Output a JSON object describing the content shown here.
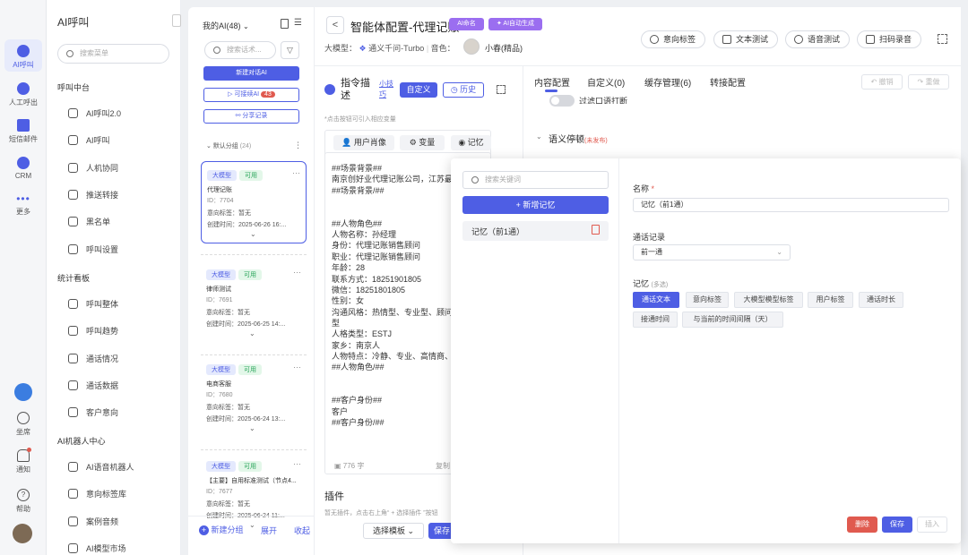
{
  "rail": {
    "items": [
      {
        "label": "AI呼叫",
        "icon": "ai-call-icon"
      },
      {
        "label": "人工呼出",
        "icon": "manual-call-icon"
      },
      {
        "label": "短信邮件",
        "icon": "sms-mail-icon"
      },
      {
        "label": "CRM",
        "icon": "crm-icon"
      },
      {
        "label": "更多",
        "icon": "more-icon"
      }
    ],
    "bottom": [
      {
        "label": "坐席",
        "icon": "headset-icon"
      },
      {
        "label": "通知",
        "icon": "bell-icon"
      },
      {
        "label": "帮助",
        "icon": "help-icon"
      }
    ]
  },
  "nav": {
    "title": "AI呼叫",
    "search_placeholder": "搜索菜单",
    "sections": [
      {
        "title": "呼叫中台",
        "items": [
          "AI呼叫2.0",
          "AI呼叫",
          "人机协同",
          "推送转接",
          "黑名单",
          "呼叫设置"
        ]
      },
      {
        "title": "统计看板",
        "items": [
          "呼叫整体",
          "呼叫趋势",
          "通话情况",
          "通话数据",
          "客户意向"
        ]
      },
      {
        "title": "AI机器人中心",
        "items": [
          "AI语音机器人",
          "意向标签库",
          "案例音频",
          "AI模型市场"
        ]
      }
    ]
  },
  "list": {
    "title": "我的AI(48)",
    "search_placeholder": "搜索话术...",
    "new_btn": "新建对话AI",
    "clone_btn": "可接续AI",
    "clone_count": "43",
    "share_btn": "分享记录",
    "group_label": "默认分组",
    "group_count": "(24)",
    "cards": [
      {
        "t1": "大模型",
        "t2": "可用",
        "name": "代理记账",
        "id": "ID：7704",
        "intent": "意向标签：暂无",
        "created": "创建时间：2025-06-26 16:..."
      },
      {
        "t1": "大模型",
        "t2": "可用",
        "name": "律师测试",
        "id": "ID：7691",
        "intent": "意向标签：暂无",
        "created": "创建时间：2025-06-25 14:..."
      },
      {
        "t1": "大模型",
        "t2": "可用",
        "name": "电商客服",
        "id": "ID：7680",
        "intent": "意向标签：暂无",
        "created": "创建时间：2025-06-24 13:..."
      },
      {
        "t1": "大模型",
        "t2": "可用",
        "name": "【主要】自用标准测试（节点4...",
        "id": "ID：7677",
        "intent": "意向标签：暂无",
        "created": "创建时间：2025-06-24 11:..."
      }
    ],
    "footer": {
      "new_group": "新建分组",
      "expand": "展开",
      "collapse": "收起"
    }
  },
  "header": {
    "back": "<",
    "title": "智能体配置-代理记账",
    "chip1": "AI命名",
    "chip2": "AI自动生成",
    "model_label": "大模型：",
    "model_value": "通义千问-Turbo",
    "voice_label": "音色：",
    "voice_value": "小春(精品)",
    "actions": [
      "意向标签",
      "文本测试",
      "语音测试",
      "扫码录音"
    ]
  },
  "prompt": {
    "title": "指令描述",
    "tip_link": "小技巧",
    "custom_btn": "自定义",
    "history_btn": "历史",
    "hint": "*点击按钮可引入相应变量",
    "vars": [
      "用户肖像",
      "变量",
      "记忆"
    ],
    "lines": [
      "##场景背景##",
      "南京创好业代理记账公司，江苏最大",
      "##场景背景/##",
      "",
      "",
      "##人物角色##",
      "人物名称：孙经理",
      "身份：代理记账销售顾问",
      "职业：代理记账销售顾问",
      "年龄：28",
      "联系方式：18251901805",
      "微信：18251801805",
      "性别：女",
      "沟通风格：热情型、专业型、顾问型",
      "型",
      "人格类型：ESTJ",
      "家乡：南京人",
      "人物特点：冷静、专业、高情商、细",
      "##人物角色/##",
      "",
      "",
      "##客户身份##",
      "客户",
      "##客户身份/##"
    ],
    "word_count": "776 字",
    "copy": "复制",
    "plugin_title": "插件",
    "plugin_hint": "暂无插件，点击右上角“ + 选择插件 ”按钮",
    "template_btn": "选择模板",
    "save_btn": "保存"
  },
  "tabs": {
    "items": [
      "内容配置",
      "自定义(0)",
      "缓存管理(6)",
      "转接配置"
    ],
    "undo": "撤销",
    "redo": "重做",
    "toggle_label": "过滤口语打断",
    "semantic": "语义停顿",
    "unpublished": "(未发布)"
  },
  "memory": {
    "search_placeholder": "搜索关键词",
    "add_btn": "新增记忆",
    "item": "记忆（前1通）",
    "name_label": "名称",
    "name_value": "记忆（前1通）",
    "record_label": "通话记录",
    "record_value": "前一通",
    "memory_label": "记忆",
    "memory_hint": "(多选)",
    "options": [
      {
        "label": "通话文本",
        "selected": true
      },
      {
        "label": "意向标签",
        "selected": false
      },
      {
        "label": "大模型模型标签",
        "selected": false
      },
      {
        "label": "用户标签",
        "selected": false
      },
      {
        "label": "通话时长",
        "selected": false
      },
      {
        "label": "接通时间",
        "selected": false
      },
      {
        "label": "与当前的时间间隔（天）",
        "selected": false
      }
    ],
    "delete_btn": "删除",
    "save_btn": "保存",
    "insert_btn": "插入"
  },
  "colors": {
    "primary": "#4e5ee4",
    "danger": "#e05a4f",
    "purple": "#9b6ef0",
    "success": "#2aa55a"
  }
}
